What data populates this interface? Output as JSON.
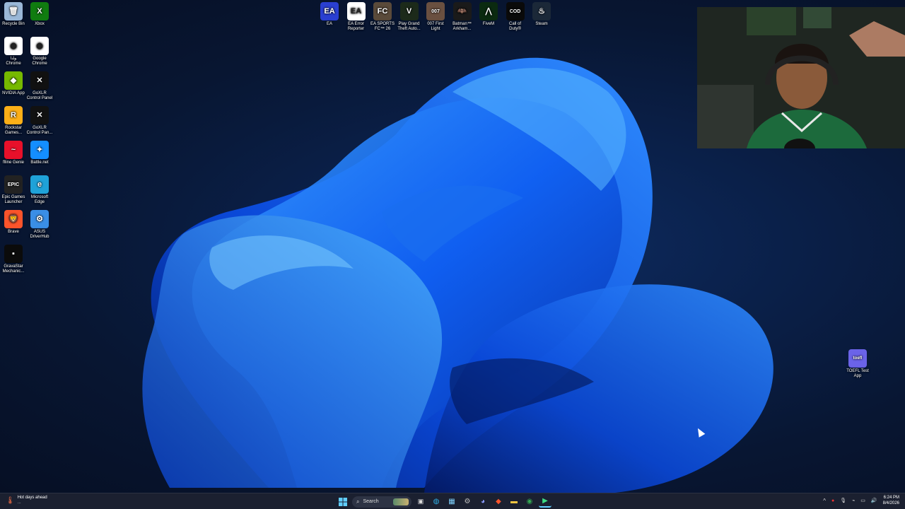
{
  "desktop": {
    "left_icons": [
      {
        "label": "Recycle Bin",
        "icon": "recycle-bin-icon",
        "color": "#9ab8d8",
        "glyph": "🗑"
      },
      {
        "label": "Xbox",
        "icon": "xbox-icon",
        "color": "#107c10",
        "glyph": "X"
      },
      {
        "label": "ﻮﻠﺑﺍ\nChrome",
        "icon": "chrome-icon",
        "color": "#ffffff",
        "glyph": "◉"
      },
      {
        "label": "Google\nChrome",
        "icon": "chrome-icon",
        "color": "#ffffff",
        "glyph": "◉"
      },
      {
        "label": "NVIDIA App",
        "icon": "nvidia-icon",
        "color": "#76b900",
        "glyph": "◆"
      },
      {
        "label": "GoXLR\nControl Panel",
        "icon": "goxlr-icon",
        "color": "#111111",
        "glyph": "✕"
      },
      {
        "label": "Rockstar\nGames...",
        "icon": "rockstar-icon",
        "color": "#fcaf17",
        "glyph": "R"
      },
      {
        "label": "GoXLR\nControl Pan...",
        "icon": "goxlr-icon",
        "color": "#111111",
        "glyph": "✕"
      },
      {
        "label": "flline Genie",
        "icon": "genie-icon",
        "color": "#e8102a",
        "glyph": "~"
      },
      {
        "label": "Battle.net",
        "icon": "battlenet-icon",
        "color": "#148eff",
        "glyph": "✦"
      },
      {
        "label": "Epic Games\nLauncher",
        "icon": "epic-games-icon",
        "color": "#222222",
        "glyph": "EPIC"
      },
      {
        "label": "Microsoft\nEdge",
        "icon": "edge-icon",
        "color": "#1fa2d8",
        "glyph": "e"
      },
      {
        "label": "Brave",
        "icon": "brave-icon",
        "color": "#fb542b",
        "glyph": "🦁"
      },
      {
        "label": "ASUS\nDriverHub",
        "icon": "asus-icon",
        "color": "#3a8ee6",
        "glyph": "⚙"
      },
      {
        "label": "GravaStar\nMechanic...",
        "icon": "gravastar-icon",
        "color": "#0b0b0b",
        "glyph": "▪"
      }
    ],
    "top_icons": [
      {
        "label": "EA",
        "icon": "ea-icon",
        "color": "#2a3fd1",
        "glyph": "EA"
      },
      {
        "label": "EA Error\nReporter",
        "icon": "ea-icon",
        "color": "#ffffff",
        "glyph": "EA"
      },
      {
        "label": "EA SPORTS\nFC™ 26",
        "icon": "fc26-icon",
        "color": "#5a4a3a",
        "glyph": "FC"
      },
      {
        "label": "Play Grand\nTheft Auto...",
        "icon": "gta-icon",
        "color": "#1c2a1a",
        "glyph": "V"
      },
      {
        "label": "007 First\nLight",
        "icon": "007-icon",
        "color": "#6a5040",
        "glyph": "007"
      },
      {
        "label": "Batman™\nArkham...",
        "icon": "batman-icon",
        "color": "#1a1a1a",
        "glyph": "🦇"
      },
      {
        "label": "FiveM",
        "icon": "fivem-icon",
        "color": "#0b2a10",
        "glyph": "⋀"
      },
      {
        "label": "Call of\nDuty®",
        "icon": "cod-icon",
        "color": "#0a0a0a",
        "glyph": "COD"
      },
      {
        "label": "Steam",
        "icon": "steam-icon",
        "color": "#1b2838",
        "glyph": "♨"
      }
    ],
    "right_icon": {
      "label": "TOEFL Test\nApp",
      "icon": "toefl-icon",
      "color": "#6b63e8",
      "glyph": "toefl"
    }
  },
  "taskbar": {
    "weather_title": "Hot days ahead",
    "weather_sub": "...",
    "search_label": "Search",
    "time": "6:24 PM",
    "date": "8/4/2026",
    "accent": "#60cdff"
  }
}
